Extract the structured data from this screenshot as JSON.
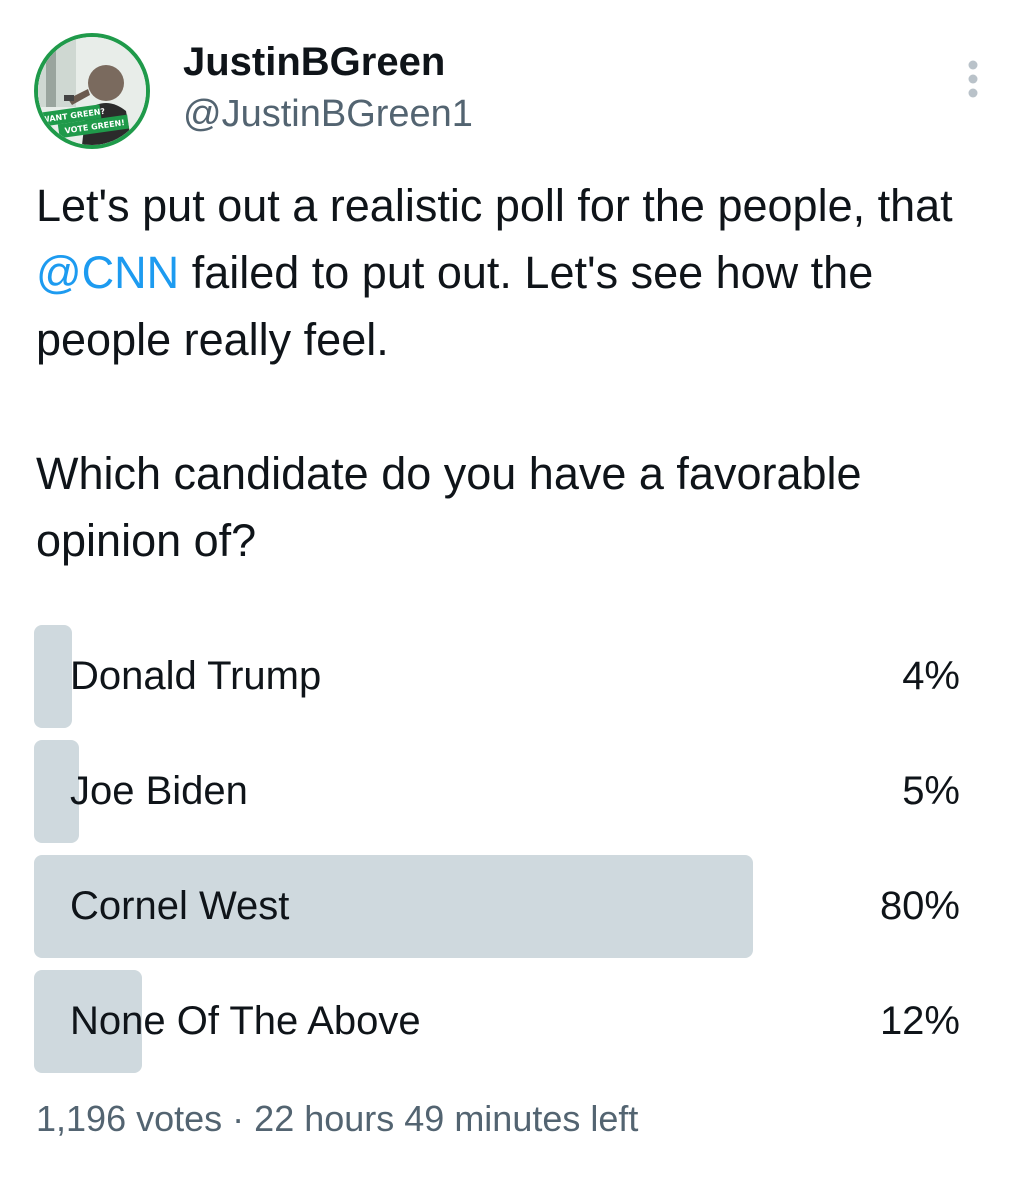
{
  "author": {
    "display_name": "JustinBGreen",
    "handle": "@JustinBGreen1",
    "avatar_text_line1": "WANT GREEN?",
    "avatar_text_line2": "VOTE GREEN!"
  },
  "tweet": {
    "text_part1": "Let's put out a realistic poll for the people, that ",
    "mention": "@CNN",
    "text_part2": " failed to put out. Let's see how the people really feel.\n\nWhich candidate do you have a favorable opinion of?"
  },
  "poll": {
    "options": [
      {
        "label": "Donald Trump",
        "percent_text": "4%",
        "percent": 4
      },
      {
        "label": "Joe Biden",
        "percent_text": "5%",
        "percent": 5
      },
      {
        "label": "Cornel West",
        "percent_text": "80%",
        "percent": 80
      },
      {
        "label": "None Of The Above",
        "percent_text": "12%",
        "percent": 12
      }
    ],
    "votes": "1,196 votes",
    "separator": "·",
    "time_left": "22 hours 49 minutes left"
  },
  "colors": {
    "text": "#0f1419",
    "secondary_text": "#536471",
    "link": "#1d9bf0",
    "poll_bar": "#cfd9de",
    "avatar_border": "#1f9a4a"
  },
  "icons": {
    "more": "more-vertical-icon"
  }
}
